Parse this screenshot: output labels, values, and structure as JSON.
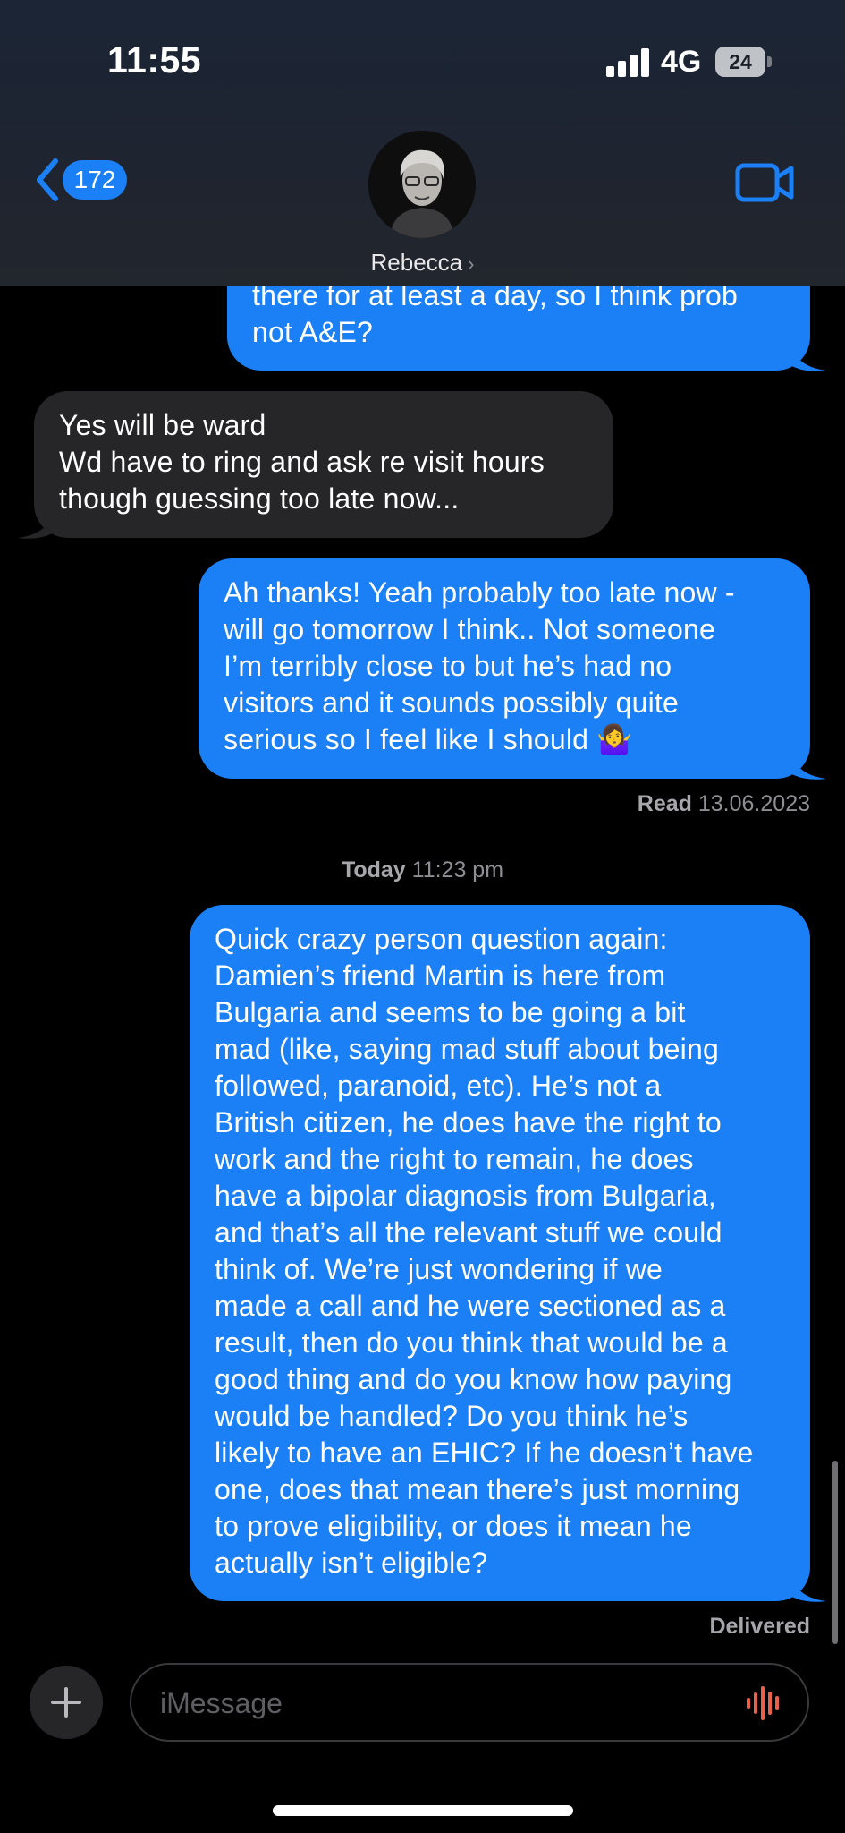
{
  "status_bar": {
    "time": "11:55",
    "network": "4G",
    "battery": "24"
  },
  "header": {
    "back_count": "172",
    "contact_name": "Rebecca"
  },
  "messages": [
    {
      "side": "out",
      "text": "there for at least a day, so I think prob\nnot A&E?"
    },
    {
      "side": "in",
      "text": "Yes will be ward\nWd have to ring and ask re visit hours\nthough guessing too late now..."
    },
    {
      "side": "out",
      "text": "Ah thanks! Yeah probably too late now -\nwill go tomorrow I think.. Not someone\nI’m terribly close to but he’s had no\nvisitors and it sounds possibly quite\nserious so I feel like I should 🤷‍♀️"
    },
    {
      "side": "out",
      "text": "Quick crazy person question again:\nDamien’s friend Martin is here from\nBulgaria and seems to be going a bit\nmad (like, saying mad stuff about being\nfollowed, paranoid, etc). He’s not a\nBritish citizen, he does have the right to\nwork and the right to remain, he does\nhave a bipolar diagnosis from Bulgaria,\nand that’s all the relevant stuff we could\nthink of. We’re just wondering if we\nmade a call and he were sectioned as a\nresult, then do you think that would be a\ngood thing and do you know how paying\nwould be handled? Do you think he’s\nlikely to have an EHIC? If he doesn’t have\none, does that mean there’s just morning\nto prove eligibility, or does it mean he\nactually isn’t eligible?"
    }
  ],
  "read_receipt": {
    "label": "Read",
    "date": "13.06.2023"
  },
  "timestamp": {
    "day": "Today",
    "time": "11:23 pm"
  },
  "delivered": "Delivered",
  "composer": {
    "placeholder": "iMessage"
  },
  "colors": {
    "outgoing": "#1b7ff6",
    "incoming": "#262628",
    "background": "#000000",
    "mic": "#e8624a"
  },
  "icons": [
    "back-chevron-icon",
    "video-camera-icon",
    "plus-icon",
    "audio-waveform-icon",
    "signal-bars-icon",
    "battery-icon",
    "chevron-right-icon",
    "shrug-emoji"
  ]
}
